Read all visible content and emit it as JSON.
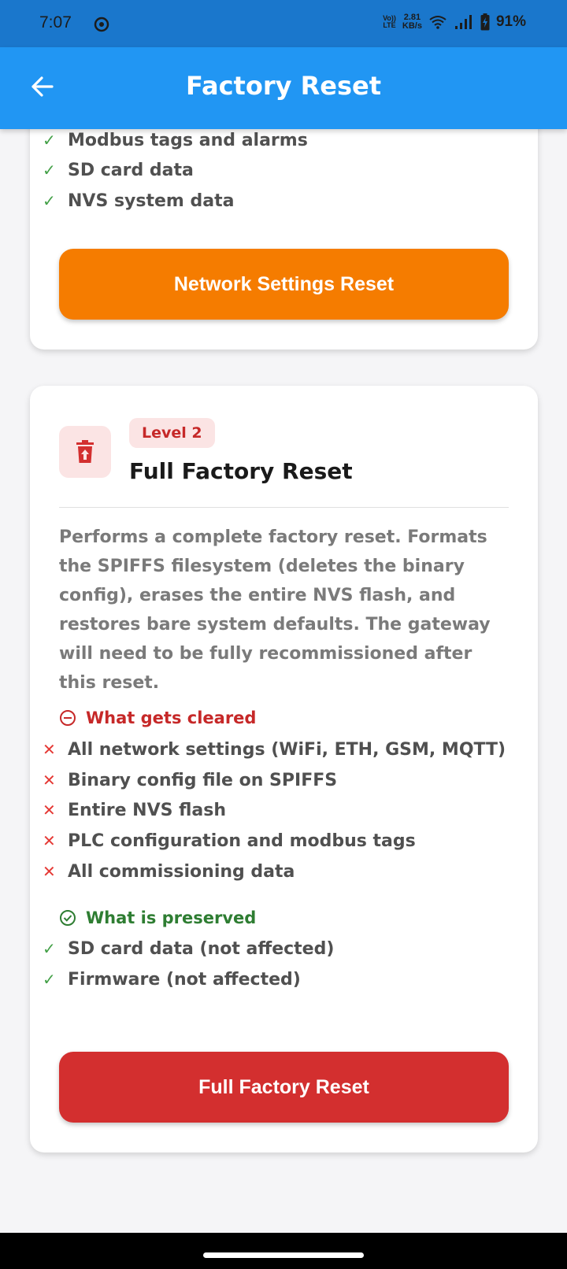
{
  "status": {
    "time": "7:07",
    "volte_top": "Vo))",
    "volte_bottom": "LTE",
    "speed_value": "2.81",
    "speed_unit": "KB/s",
    "battery": "91%"
  },
  "appbar": {
    "title": "Factory Reset"
  },
  "card_network": {
    "items": [
      "Modbus tags and alarms",
      "SD card data",
      "NVS system data"
    ],
    "button_label": "Network Settings Reset"
  },
  "card_full": {
    "level": "Level 2",
    "title": "Full Factory Reset",
    "description": "Performs a complete factory reset. Formats the SPIFFS filesystem (deletes the binary config), erases the entire NVS flash, and restores bare system defaults. The gateway will need to be fully recommissioned after this reset.",
    "cleared_header": "What gets cleared",
    "cleared_items": [
      "All network settings (WiFi, ETH, GSM, MQTT)",
      "Binary config file on SPIFFS",
      "Entire NVS flash",
      "PLC configuration and modbus tags",
      "All commissioning data"
    ],
    "preserved_header": "What is preserved",
    "preserved_items": [
      "SD card data (not affected)",
      "Firmware (not affected)"
    ],
    "button_label": "Full Factory Reset"
  },
  "colors": {
    "appbar": "#2196f3",
    "orange_button": "#f57c00",
    "red_button": "#d32f2f",
    "cleared": "#c62828",
    "preserved": "#2e7d32"
  }
}
